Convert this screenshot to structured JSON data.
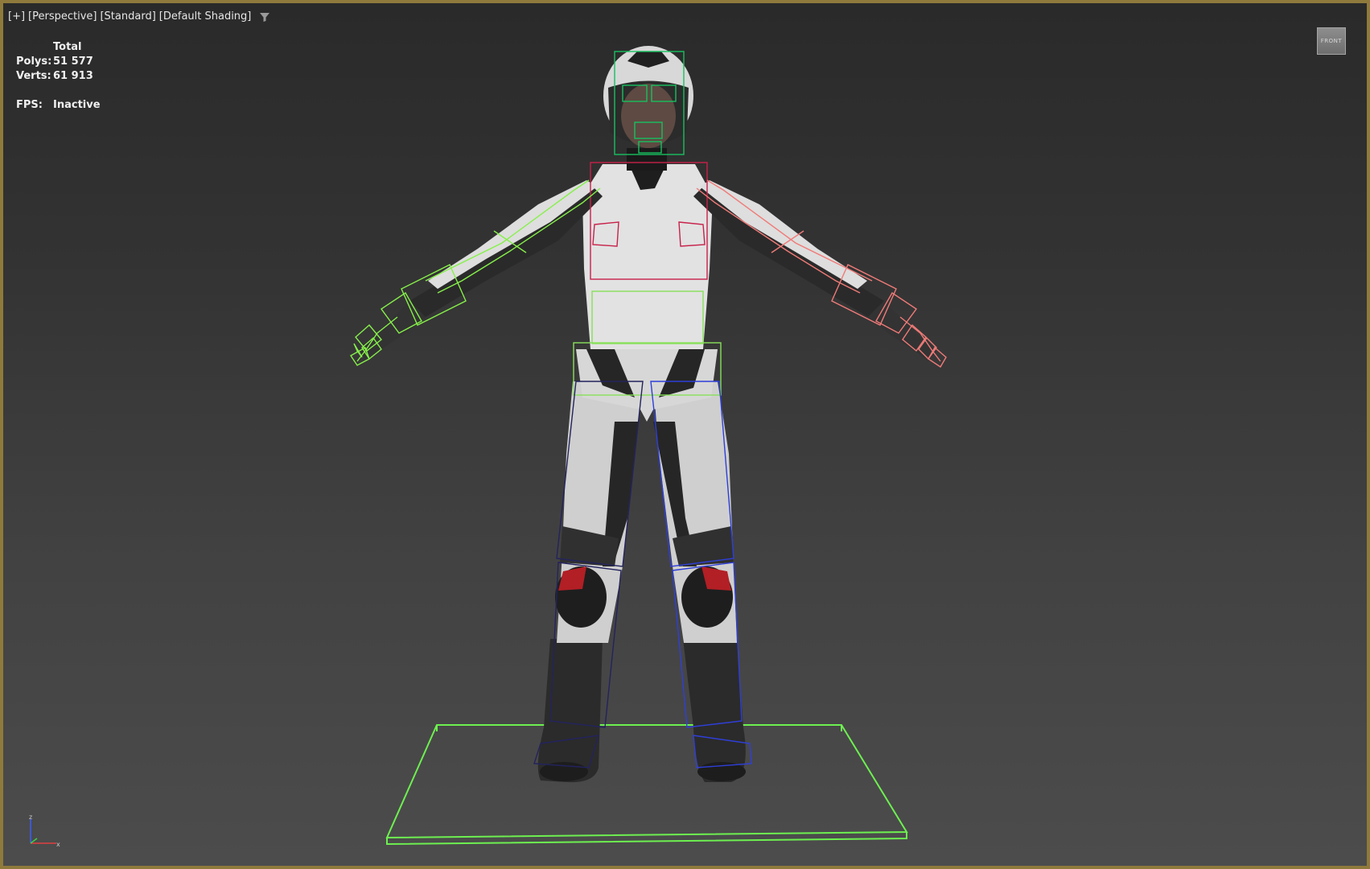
{
  "viewport": {
    "label_plus": "[+]",
    "label_view": "[Perspective]",
    "label_mode": "[Standard]",
    "label_shading": "[Default Shading]",
    "filter_icon": "funnel-icon",
    "border_color": "#8f7a3c"
  },
  "stats": {
    "header": "Total",
    "polys_label": "Polys:",
    "polys_value": "51 577",
    "verts_label": "Verts:",
    "verts_value": "61 913",
    "fps_label": "FPS:",
    "fps_value": "Inactive"
  },
  "viewcube": {
    "label": "FRONT"
  },
  "axis_gizmo": {
    "z_label": "z",
    "x_label": "x"
  },
  "colors": {
    "left_arm_bones": "#86f04a",
    "right_arm_bones": "#f07b78",
    "spine_bones": "#88e05a",
    "chest_bones": "#c7214a",
    "head_bones": "#18c060",
    "left_leg_bones": "#23235e",
    "right_leg_bones": "#2f3fd8",
    "ground_box": "#6df050"
  }
}
